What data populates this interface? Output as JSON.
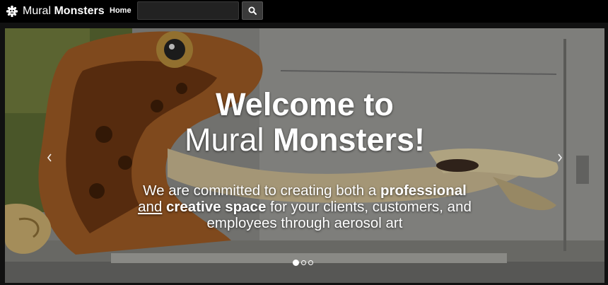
{
  "nav": {
    "brand_light": "Mural",
    "brand_bold": "Monsters",
    "home_label": "Home",
    "search_value": "",
    "search_icon": "search-icon"
  },
  "hero": {
    "title_line1": "Welcome to",
    "title_line2_light": "Mural",
    "title_line2_bold": "Monsters!",
    "text_part1": "We are committed to creating both a",
    "text_bold1": "professional",
    "text_and": "and",
    "text_bold2": "creative space",
    "text_part2": "for your clients, customers, and employees through aerosol art",
    "prev_icon": "chevron-left-icon",
    "next_icon": "chevron-right-icon",
    "slides": [
      {
        "active": true
      },
      {
        "active": false
      },
      {
        "active": false
      }
    ]
  },
  "colors": {
    "navbar": "#000000",
    "search_field": "#222222",
    "search_button": "#3a3a3a"
  }
}
